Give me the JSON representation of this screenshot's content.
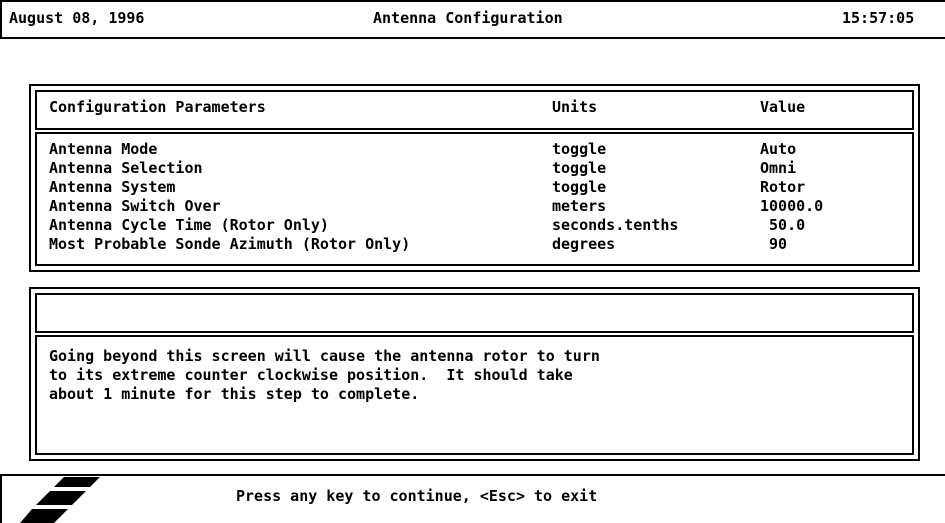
{
  "header": {
    "date": "August 08, 1996",
    "title": "Antenna Configuration",
    "time": "15:57:05"
  },
  "table": {
    "col_parameter": "Configuration Parameters",
    "col_units": "Units",
    "col_value": "Value",
    "rows": [
      {
        "parameter": "Antenna Mode",
        "units": "toggle",
        "value": "Auto"
      },
      {
        "parameter": "Antenna Selection",
        "units": "toggle",
        "value": "Omni"
      },
      {
        "parameter": "Antenna System",
        "units": "toggle",
        "value": "Rotor"
      },
      {
        "parameter": "Antenna Switch Over",
        "units": "meters",
        "value": "10000.0"
      },
      {
        "parameter": "Antenna Cycle Time (Rotor Only)",
        "units": "seconds.tenths",
        "value": " 50.0"
      },
      {
        "parameter": "Most Probable Sonde Azimuth (Rotor Only)",
        "units": "degrees",
        "value": " 90"
      }
    ]
  },
  "message": {
    "input_value": "",
    "line1": "Going beyond this screen will cause the antenna rotor to turn",
    "line2": "to its extreme counter clockwise position.  It should take",
    "line3": "about 1 minute for this step to complete."
  },
  "footer": {
    "logo_icon": "slanted-stripes-logo-icon",
    "prompt": "Press any key to continue, <Esc> to exit"
  }
}
